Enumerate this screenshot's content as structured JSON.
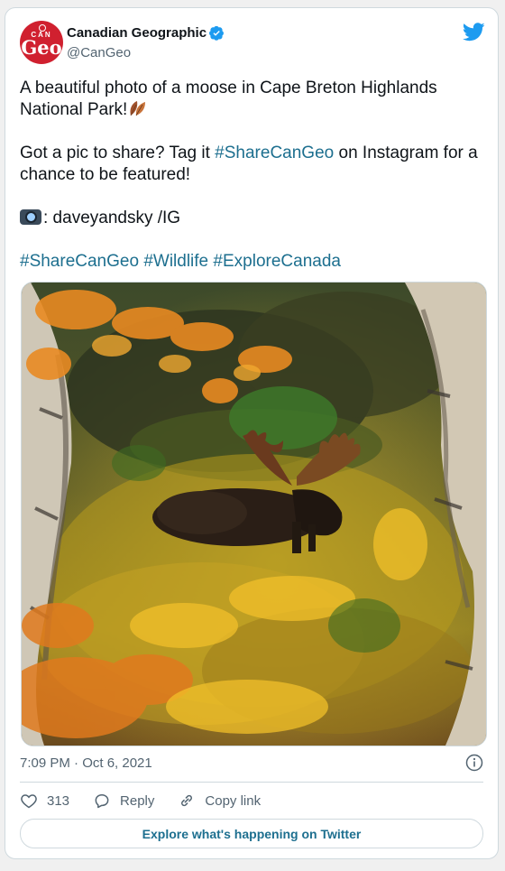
{
  "account": {
    "name": "Canadian Geographic",
    "handle": "@CanGeo",
    "avatar_text_top": "CAN",
    "avatar_text_main": "Geo",
    "verified_icon": "verified-badge-icon"
  },
  "tweet": {
    "line1": "A beautiful photo of a moose in Cape Breton Highlands National Park!",
    "line2_before": "Got a pic to share? Tag it ",
    "line2_tag": "#ShareCanGeo",
    "line2_after": " on Instagram for a chance to be featured!",
    "credit": ": daveyandsky /IG",
    "hashtags": [
      "#ShareCanGeo",
      "#Wildlife",
      "#ExploreCanada"
    ]
  },
  "meta": {
    "timestamp": "7:09 PM · Oct 6, 2021"
  },
  "actions": {
    "likes": "313",
    "reply_label": "Reply",
    "copy_label": "Copy link"
  },
  "explore_label": "Explore what's happening on Twitter",
  "colors": {
    "link": "#1d6f8f",
    "twitter_blue": "#1d9bf0",
    "brand_red": "#d0202f"
  }
}
